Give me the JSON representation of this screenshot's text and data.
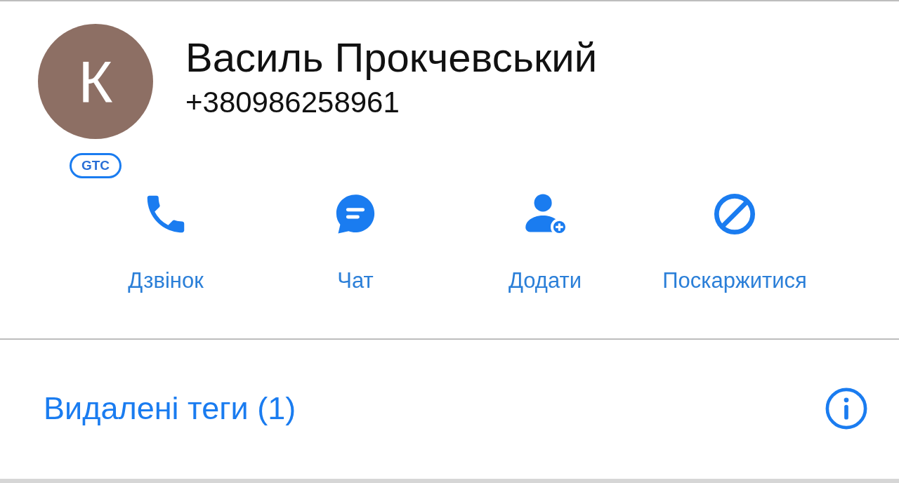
{
  "contact": {
    "avatar_initial": "К",
    "name": "Василь Прокчевський",
    "phone": "+380986258961",
    "badge": "GTC"
  },
  "actions": [
    {
      "kind": "call",
      "label": "Дзвінок"
    },
    {
      "kind": "chat",
      "label": "Чат"
    },
    {
      "kind": "add",
      "label": "Додати"
    },
    {
      "kind": "report",
      "label": "Поскаржитися"
    }
  ],
  "deleted_tags": {
    "label": "Видалені теги (1)"
  }
}
